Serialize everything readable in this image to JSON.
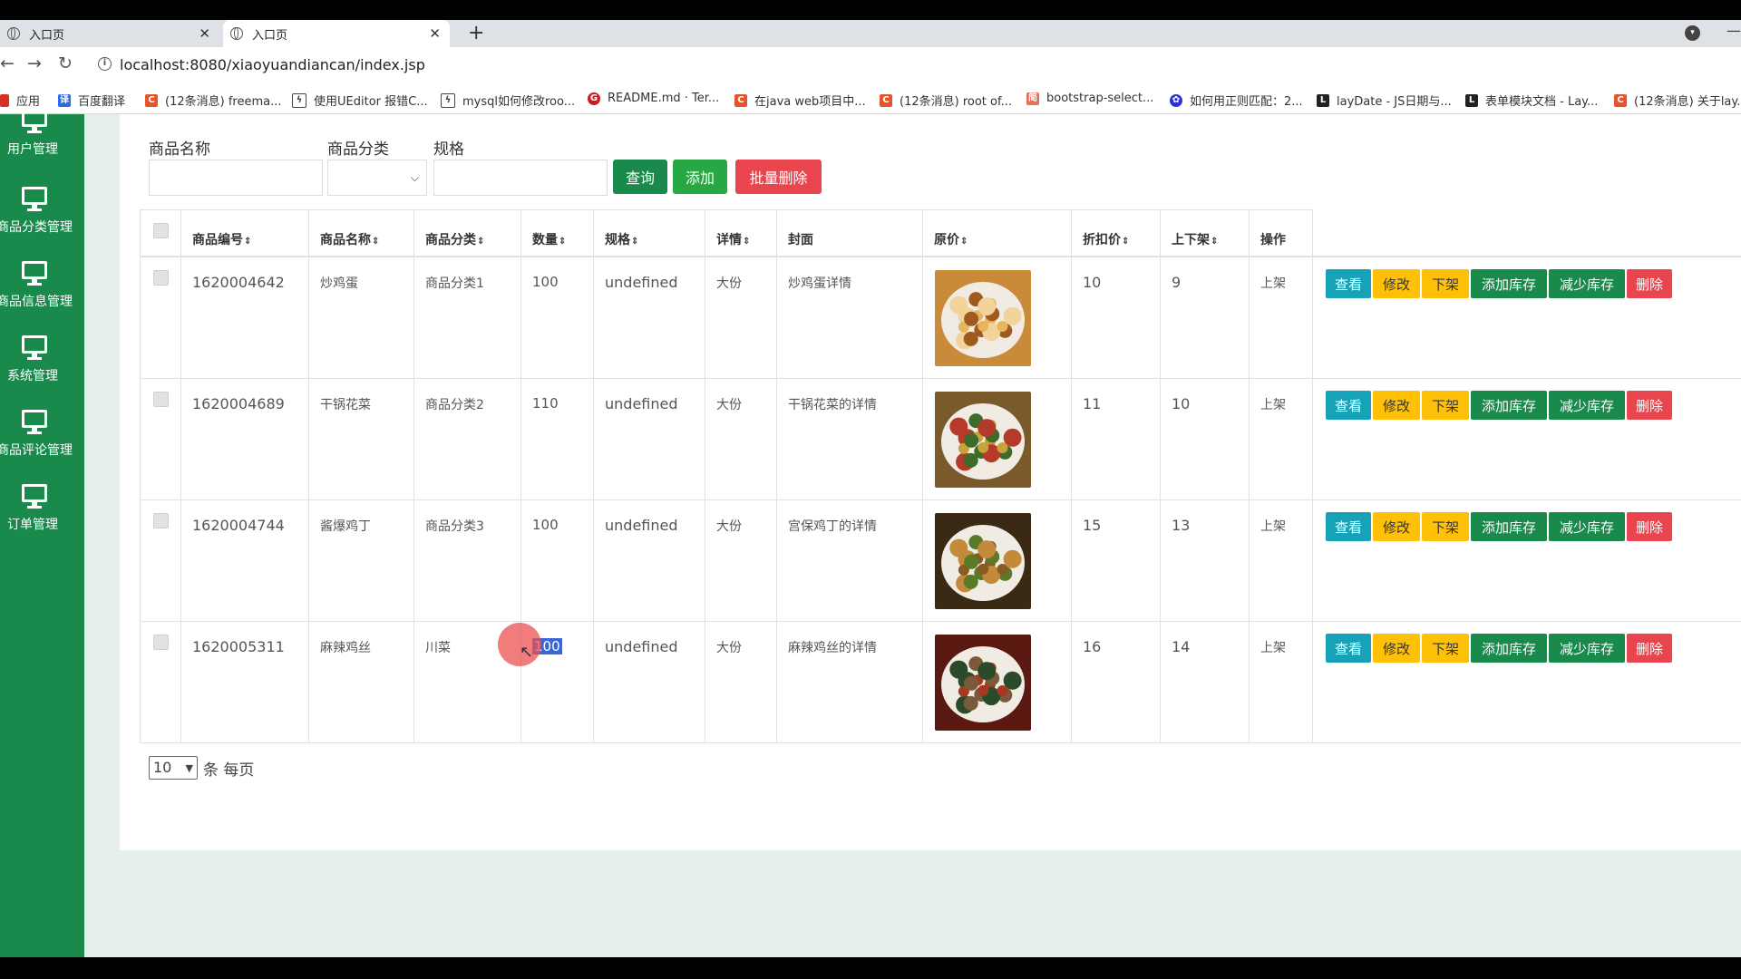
{
  "browser": {
    "tabs": [
      {
        "label": "入口页",
        "active": false
      },
      {
        "label": "入口页",
        "active": true
      }
    ],
    "new_tab": "+",
    "url": "localhost:8080/xiaoyuandiancan/index.jsp",
    "bookmarks": [
      {
        "label": "应用",
        "icon": "apps-grid-icon",
        "color": "#d93025"
      },
      {
        "label": "百度翻译",
        "icon": "baidu-fanyi-icon",
        "color": "#2a6be8"
      },
      {
        "label": "(12条消息) freema...",
        "icon": "csdn-icon",
        "color": "#e8542a"
      },
      {
        "label": "使用UEditor 报错C...",
        "icon": "bird-icon",
        "color": "#444444"
      },
      {
        "label": "mysql如何修改roo...",
        "icon": "bird-icon",
        "color": "#444444"
      },
      {
        "label": "README.md · Ter...",
        "icon": "gitee-icon",
        "color": "#c71d23"
      },
      {
        "label": "在java web项目中...",
        "icon": "csdn-icon",
        "color": "#e8542a"
      },
      {
        "label": "(12条消息) root of...",
        "icon": "csdn-icon",
        "color": "#e8542a"
      },
      {
        "label": "bootstrap-select...",
        "icon": "jianshu-icon",
        "color": "#ea6f5a"
      },
      {
        "label": "如何用正则匹配：2...",
        "icon": "baidu-paw-icon",
        "color": "#2932e1"
      },
      {
        "label": "layDate - JS日期与...",
        "icon": "layui-icon",
        "color": "#222222"
      },
      {
        "label": "表单模块文档 - Lay...",
        "icon": "layui-icon",
        "color": "#222222"
      },
      {
        "label": "(12条消息) 关于lay...",
        "icon": "csdn-icon",
        "color": "#e8542a"
      }
    ]
  },
  "sidebar": {
    "items": [
      {
        "label": "用户管理"
      },
      {
        "label": "商品分类管理"
      },
      {
        "label": "商品信息管理"
      },
      {
        "label": "系统管理"
      },
      {
        "label": "商品评论管理"
      },
      {
        "label": "订单管理"
      }
    ]
  },
  "filters": {
    "name_label": "商品名称",
    "category_label": "商品分类",
    "spec_label": "规格",
    "query_btn": "查询",
    "add_btn": "添加",
    "batch_delete_btn": "批量删除"
  },
  "table": {
    "headers": [
      "商品编号",
      "商品名称",
      "商品分类",
      "数量",
      "规格",
      "详情",
      "封面",
      "原价",
      "折扣价",
      "上下架",
      "操作"
    ],
    "sort_icon": "⇕",
    "rows": [
      {
        "id": "1620004642",
        "name": "炒鸡蛋",
        "category": "商品分类1",
        "qty": "100",
        "spec": "undefined",
        "detail": "大份",
        "cover": "炒鸡蛋详情",
        "orig": "10",
        "discount": "9",
        "status": "上架"
      },
      {
        "id": "1620004689",
        "name": "干锅花菜",
        "category": "商品分类2",
        "qty": "110",
        "spec": "undefined",
        "detail": "大份",
        "cover": "干锅花菜的详情",
        "orig": "11",
        "discount": "10",
        "status": "上架"
      },
      {
        "id": "1620004744",
        "name": "酱爆鸡丁",
        "category": "商品分类3",
        "qty": "100",
        "spec": "undefined",
        "detail": "大份",
        "cover": "宫保鸡丁的详情",
        "orig": "15",
        "discount": "13",
        "status": "上架"
      },
      {
        "id": "1620005311",
        "name": "麻辣鸡丝",
        "category": "川菜",
        "qty": "100",
        "spec": "undefined",
        "detail": "大份",
        "cover": "麻辣鸡丝的详情",
        "orig": "16",
        "discount": "14",
        "status": "上架"
      }
    ],
    "actions": {
      "view": "查看",
      "edit": "修改",
      "offshelf": "下架",
      "add_stock": "添加库存",
      "reduce_stock": "减少库存",
      "delete": "删除"
    }
  },
  "pager": {
    "page_size": "10",
    "suffix": "条 每页"
  },
  "colors": {
    "sidebar_green": "#1a8a4c",
    "info": "#17a2b8",
    "warning": "#ffc107",
    "danger": "#e8454f"
  }
}
